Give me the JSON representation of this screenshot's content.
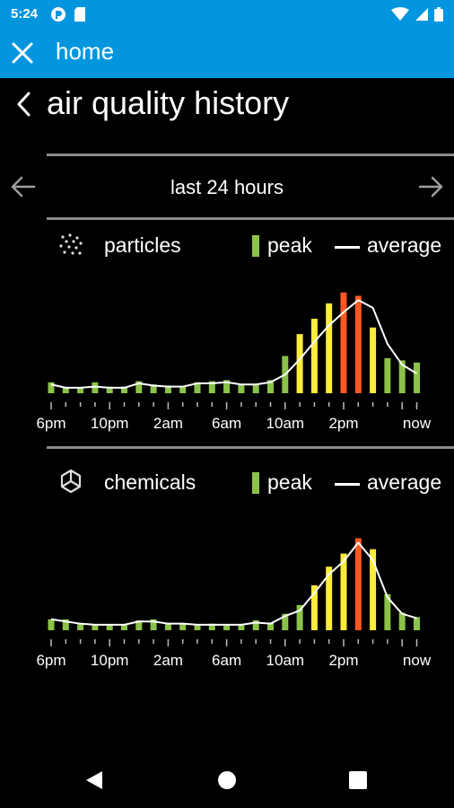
{
  "status_bar": {
    "time": "5:24"
  },
  "app_bar": {
    "title": "home"
  },
  "screen": {
    "title": "air quality history"
  },
  "range": {
    "label": "last 24 hours"
  },
  "legend": {
    "peak": "peak",
    "average": "average"
  },
  "colors": {
    "accent": "#0396de",
    "green": "#8bc34a",
    "yellow": "#ffeb3b",
    "orange": "#ff5722"
  },
  "chart_data": [
    {
      "type": "bar",
      "title": "particles",
      "x_tick_labels": [
        "6pm",
        "10pm",
        "2am",
        "6am",
        "10am",
        "2pm",
        "now"
      ],
      "series": [
        {
          "name": "peak",
          "values": [
            1.0,
            0.5,
            0.5,
            1.0,
            0.6,
            0.6,
            1.1,
            0.8,
            0.7,
            0.6,
            1.0,
            1.1,
            1.2,
            0.8,
            0.8,
            1.2,
            3.4,
            5.4,
            6.8,
            8.2,
            9.2,
            8.9,
            6.0,
            3.2,
            3.0,
            2.8
          ],
          "colors": [
            "green",
            "green",
            "green",
            "green",
            "green",
            "green",
            "green",
            "green",
            "green",
            "green",
            "green",
            "green",
            "green",
            "green",
            "green",
            "green",
            "green",
            "yellow",
            "yellow",
            "yellow",
            "orange",
            "orange",
            "yellow",
            "green",
            "green",
            "green"
          ]
        },
        {
          "name": "average",
          "values": [
            0.8,
            0.5,
            0.5,
            0.6,
            0.5,
            0.5,
            0.9,
            0.7,
            0.6,
            0.6,
            0.9,
            0.9,
            1.0,
            0.8,
            0.8,
            1.0,
            1.7,
            3.1,
            4.7,
            6.2,
            7.4,
            8.5,
            7.8,
            4.5,
            2.6,
            1.8
          ]
        }
      ]
    },
    {
      "type": "bar",
      "title": "chemicals",
      "x_tick_labels": [
        "6pm",
        "10pm",
        "2am",
        "6am",
        "10am",
        "2pm",
        "now"
      ],
      "series": [
        {
          "name": "peak",
          "values": [
            1.0,
            1.0,
            0.6,
            0.5,
            0.5,
            0.5,
            0.9,
            1.0,
            0.6,
            0.6,
            0.5,
            0.6,
            0.5,
            0.5,
            0.9,
            0.7,
            1.5,
            2.3,
            4.1,
            5.8,
            7.0,
            8.4,
            7.4,
            3.3,
            1.6,
            1.2
          ],
          "colors": [
            "green",
            "green",
            "green",
            "green",
            "green",
            "green",
            "green",
            "green",
            "green",
            "green",
            "green",
            "green",
            "green",
            "green",
            "green",
            "green",
            "green",
            "green",
            "yellow",
            "yellow",
            "yellow",
            "orange",
            "yellow",
            "green",
            "green",
            "green"
          ]
        },
        {
          "name": "average",
          "values": [
            1.0,
            0.8,
            0.6,
            0.5,
            0.5,
            0.5,
            0.8,
            0.8,
            0.6,
            0.6,
            0.5,
            0.5,
            0.5,
            0.5,
            0.7,
            0.6,
            1.3,
            1.8,
            3.4,
            5.1,
            6.3,
            8.0,
            6.4,
            3.0,
            1.5,
            1.1
          ]
        }
      ]
    }
  ]
}
